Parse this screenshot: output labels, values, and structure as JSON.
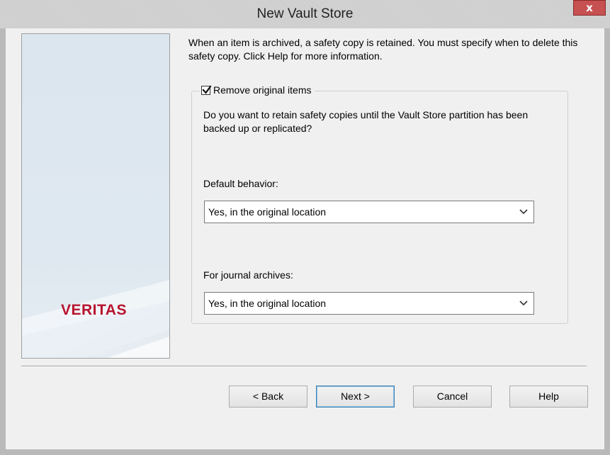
{
  "window": {
    "title": "New Vault Store",
    "close_glyph": "x"
  },
  "brand": {
    "logo_text": "VERITAS",
    "logo_color": "#b8122d"
  },
  "intro": {
    "text": "When an item is archived, a safety copy is retained. You must specify when to delete this safety copy. Click Help for more information."
  },
  "options": {
    "remove_original": {
      "label": "Remove original items",
      "checked": true
    },
    "question": "Do you want to retain safety copies until the Vault Store partition has been backed up or replicated?",
    "default_behavior": {
      "label": "Default behavior:",
      "value": "Yes, in the original location"
    },
    "journal_archives": {
      "label": "For journal archives:",
      "value": "Yes, in the original location"
    }
  },
  "buttons": {
    "back": "< Back",
    "next": "Next >",
    "cancel": "Cancel",
    "help": "Help"
  },
  "icons": {
    "close": "close-icon",
    "dropdown": "chevron-down-icon",
    "check": "checkmark-icon"
  }
}
